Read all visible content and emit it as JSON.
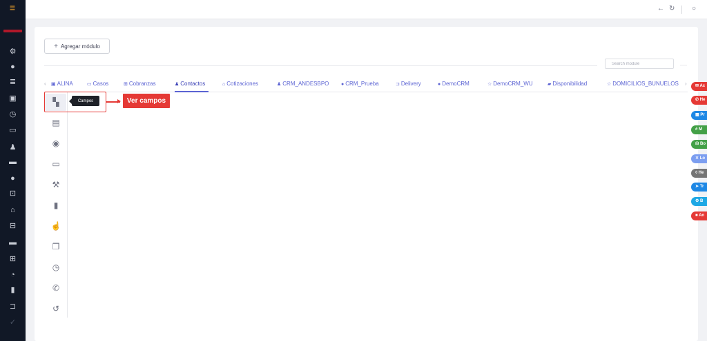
{
  "sidebar": {
    "menu_icon": "menu-icon",
    "logo": "brand-logo",
    "items": [
      {
        "name": "settings-icon",
        "glyph": "⚙"
      },
      {
        "name": "user-circle-icon",
        "glyph": "●"
      },
      {
        "name": "list-icon",
        "glyph": "≣"
      },
      {
        "name": "id-card-icon",
        "glyph": "▣"
      },
      {
        "name": "history-icon",
        "glyph": "◷"
      },
      {
        "name": "calendar-icon",
        "glyph": "▭"
      },
      {
        "name": "user-icon",
        "glyph": "♟"
      },
      {
        "name": "briefcase-icon",
        "glyph": "▬"
      },
      {
        "name": "help-icon",
        "glyph": "●"
      },
      {
        "name": "cart-icon",
        "glyph": "⊡"
      },
      {
        "name": "bag-icon",
        "glyph": "⌂"
      },
      {
        "name": "car-icon",
        "glyph": "⊟"
      },
      {
        "name": "monitor-icon",
        "glyph": "▬"
      },
      {
        "name": "ticket-icon",
        "glyph": "⊞"
      },
      {
        "name": "clock-icon",
        "glyph": "◔"
      },
      {
        "name": "chart-icon",
        "glyph": "▮"
      },
      {
        "name": "truck-icon",
        "glyph": "⊐"
      },
      {
        "name": "check-icon",
        "glyph": "✓"
      }
    ]
  },
  "topbar": {
    "back_icon": "←",
    "refresh_icon": "↻",
    "circle_icon": "○"
  },
  "main": {
    "add_module_label": "Agregar módulo",
    "search_placeholder": "Search module",
    "tabs": [
      {
        "label": "ALINA",
        "icon": "▣"
      },
      {
        "label": "Casos",
        "icon": "▭"
      },
      {
        "label": "Cobranzas",
        "icon": "⊞"
      },
      {
        "label": "Contactos",
        "icon": "♟"
      },
      {
        "label": "Cotizaciones",
        "icon": "⌂"
      },
      {
        "label": "CRM_ANDESBPO",
        "icon": "♟"
      },
      {
        "label": "CRM_Prueba",
        "icon": "●"
      },
      {
        "label": "Delivery",
        "icon": "⊐"
      },
      {
        "label": "DemoCRM",
        "icon": "●"
      },
      {
        "label": "DemoCRM_WU",
        "icon": "☆"
      },
      {
        "label": "Disponibilidad",
        "icon": "▰"
      },
      {
        "label": "DOMICILIOS_BUNUELOS",
        "icon": "☆"
      }
    ],
    "active_tab": "Contactos",
    "toolbar": [
      {
        "name": "fields-icon",
        "glyph": "▚"
      },
      {
        "name": "document-icon",
        "glyph": "▤"
      },
      {
        "name": "eye-icon",
        "glyph": "◉"
      },
      {
        "name": "comment-icon",
        "glyph": "▭"
      },
      {
        "name": "gavel-icon",
        "glyph": "⚒"
      },
      {
        "name": "book-icon",
        "glyph": "▮"
      },
      {
        "name": "hand-pointer-icon",
        "glyph": "☝"
      },
      {
        "name": "copy-icon",
        "glyph": "❐"
      },
      {
        "name": "alarm-icon",
        "glyph": "◷"
      },
      {
        "name": "phone-icon",
        "glyph": "✆"
      },
      {
        "name": "history-icon",
        "glyph": "↺"
      }
    ],
    "tooltip": "Campos",
    "callout": "Ver campos"
  },
  "floating_buttons": [
    {
      "label": "✉ Ac",
      "color": "#e53935"
    },
    {
      "label": "✆ He",
      "color": "#e53935"
    },
    {
      "label": "▦ Pr",
      "color": "#1e88e5"
    },
    {
      "label": "# M",
      "color": "#43a047"
    },
    {
      "label": "☊ Bo",
      "color": "#43a047"
    },
    {
      "label": "✕ Lo",
      "color": "#7c9ef0"
    },
    {
      "label": "◊ He",
      "color": "#757575"
    },
    {
      "label": "➤ Tr",
      "color": "#1e88e5"
    },
    {
      "label": "⚙ B",
      "color": "#1ea8e5"
    },
    {
      "label": "■ An",
      "color": "#e53935"
    }
  ]
}
